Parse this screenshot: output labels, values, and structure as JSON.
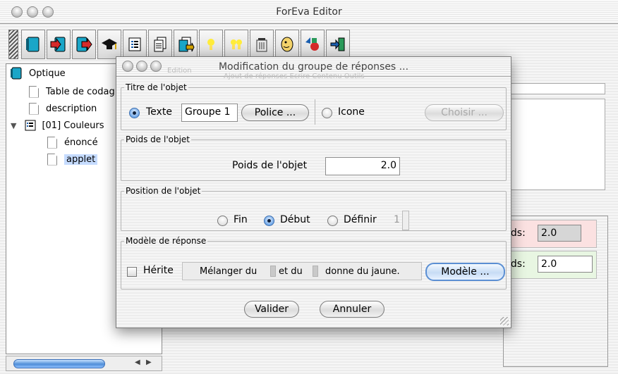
{
  "window": {
    "title": "ForEva Editor"
  },
  "toolbar": {
    "buttons": [
      {
        "name": "open-book-icon"
      },
      {
        "name": "import-icon"
      },
      {
        "name": "export-icon"
      },
      {
        "name": "graduation-cap-icon"
      },
      {
        "name": "list-icon"
      },
      {
        "name": "pages-icon"
      },
      {
        "name": "copy-pages-icon"
      },
      {
        "name": "lightbulb-icon"
      },
      {
        "name": "double-lightbulb-icon"
      },
      {
        "name": "trash-icon"
      },
      {
        "name": "head-icon"
      },
      {
        "name": "shapes-icon"
      },
      {
        "name": "exit-door-icon"
      }
    ]
  },
  "tree": {
    "root": "Optique",
    "items": [
      {
        "label": "Table de codag"
      },
      {
        "label": "description"
      },
      {
        "label": "[01] Couleurs"
      },
      {
        "label": "énoncé"
      },
      {
        "label": "applet"
      }
    ]
  },
  "right": {
    "poids_label_1": "ids:",
    "poids_value_1": "2.0",
    "poids_label_2": "ids:",
    "poids_value_2": "2.0"
  },
  "dialog": {
    "title": "Modification du groupe de réponses ...",
    "ghost_menu": "Edition",
    "ghost_menu_2": "Ajout de réponses   Ecrire   Contenu   Outils",
    "titre": {
      "legend": "Titre de l'objet",
      "texte_label": "Texte",
      "texte_value": "Groupe 1",
      "police_button": "Police ...",
      "icone_label": "Icone",
      "choisir_button": "Choisir ..."
    },
    "poids": {
      "legend": "Poids de l'objet",
      "label": "Poids de l'objet",
      "value": "2.0"
    },
    "position": {
      "legend": "Position de l'objet",
      "fin_label": "Fin",
      "debut_label": "Début",
      "definir_label": "Définir",
      "definir_value": "1"
    },
    "modele": {
      "legend": "Modèle de réponse",
      "herite_label": "Hérite",
      "seg1": "Mélanger du",
      "seg2": "et du",
      "seg3": "donne du jaune.",
      "modele_button": "Modèle ..."
    },
    "valider_button": "Valider",
    "annuler_button": "Annuler"
  }
}
